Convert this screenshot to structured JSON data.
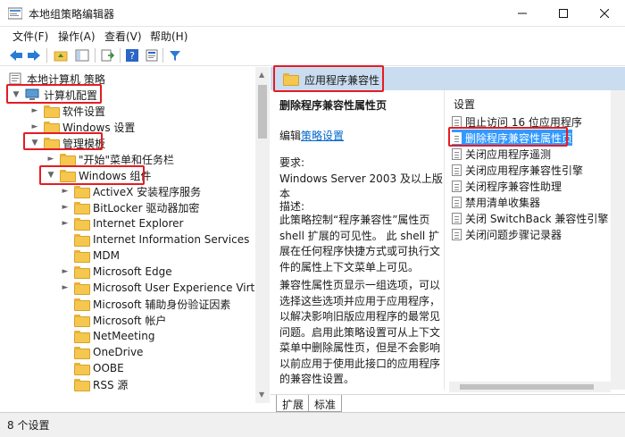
{
  "window": {
    "title": "本地组策略编辑器"
  },
  "menu": [
    "文件(F)",
    "操作(A)",
    "查看(V)",
    "帮助(H)"
  ],
  "tree": {
    "root": "本地计算机 策略",
    "items": [
      {
        "label": "计算机配置",
        "depth": 0,
        "expanded": true
      },
      {
        "label": "软件设置",
        "depth": 1,
        "expanded": false
      },
      {
        "label": "Windows 设置",
        "depth": 1,
        "expanded": false
      },
      {
        "label": "管理模板",
        "depth": 1,
        "expanded": true
      },
      {
        "label": "\"开始\"菜单和任务栏",
        "depth": 2,
        "expanded": false
      },
      {
        "label": "Windows 组件",
        "depth": 2,
        "expanded": true
      },
      {
        "label": "ActiveX 安装程序服务",
        "depth": 3,
        "expanded": false
      },
      {
        "label": "BitLocker 驱动器加密",
        "depth": 3,
        "expanded": false
      },
      {
        "label": "Internet Explorer",
        "depth": 3,
        "expanded": false
      },
      {
        "label": "Internet Information Services",
        "depth": 3,
        "expanded": false
      },
      {
        "label": "MDM",
        "depth": 3,
        "expanded": false
      },
      {
        "label": "Microsoft Edge",
        "depth": 3,
        "expanded": false
      },
      {
        "label": "Microsoft User Experience Virtualiz",
        "depth": 3,
        "expanded": false
      },
      {
        "label": "Microsoft 辅助身份验证因素",
        "depth": 3,
        "expanded": false
      },
      {
        "label": "Microsoft 帐户",
        "depth": 3,
        "expanded": false
      },
      {
        "label": "NetMeeting",
        "depth": 3,
        "expanded": false
      },
      {
        "label": "OneDrive",
        "depth": 3,
        "expanded": false
      },
      {
        "label": "OOBE",
        "depth": 3,
        "expanded": false
      },
      {
        "label": "RSS 源",
        "depth": 3,
        "expanded": false
      }
    ]
  },
  "right": {
    "folder_title": "应用程序兼容性",
    "policy_title": "删除程序兼容性属性页",
    "edit_prefix": "编辑",
    "edit_link": "策略设置",
    "requirements_label": "要求:",
    "requirements_value": "Windows Server 2003 及以上版本",
    "description_label": "描述:",
    "description_p1": "此策略控制“程序兼容性”属性页 shell 扩展的可见性。 此 shell 扩展在任何程序快捷方式或可执行文件的属性上下文菜单上可见。",
    "description_p2": "兼容性属性页显示一组选项，可以选择这些选项并应用于应用程序，以解决影响旧版应用程序的最常见问题。启用此策略设置可从上下文菜单中删除属性页，但是不会影响以前应用于使用此接口的应用程序的兼容性设置。",
    "settings_header": "设置",
    "settings": [
      {
        "label": "阻止访问 16 位应用程序",
        "selected": false
      },
      {
        "label": "删除程序兼容性属性页",
        "selected": true
      },
      {
        "label": "关闭应用程序遥测",
        "selected": false
      },
      {
        "label": "关闭应用程序兼容性引擎",
        "selected": false
      },
      {
        "label": "关闭程序兼容性助理",
        "selected": false
      },
      {
        "label": "禁用清单收集器",
        "selected": false
      },
      {
        "label": "关闭 SwitchBack 兼容性引擎",
        "selected": false
      },
      {
        "label": "关闭问题步骤记录器",
        "selected": false
      }
    ],
    "tabs": [
      "扩展",
      "标准"
    ]
  },
  "status": {
    "text": "8 个设置"
  }
}
